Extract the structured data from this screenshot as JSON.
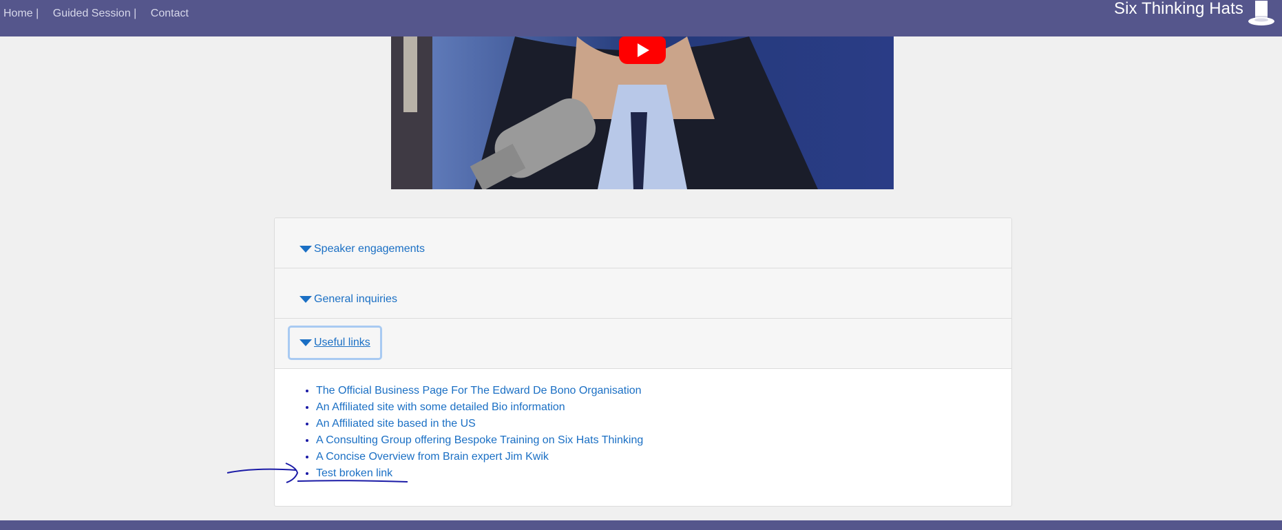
{
  "nav": {
    "home": "Home",
    "guided": "Guided Session",
    "contact": "Contact",
    "separator": "|"
  },
  "brand": {
    "title": "Six Thinking Hats",
    "icon": "top-hat-icon"
  },
  "video": {
    "play_icon": "youtube-play-icon"
  },
  "accordion": {
    "items": [
      {
        "label": "Speaker engagements"
      },
      {
        "label": "General inquiries"
      },
      {
        "label": "Useful links"
      }
    ]
  },
  "useful_links": [
    "The Official Business Page For The Edward De Bono Organisation",
    "An Affiliated site with some detailed Bio information",
    "An Affiliated site based in the US",
    "A Consulting Group offering Bespoke Training on Six Hats Thinking",
    "A Concise Overview from Brain expert Jim Kwik",
    "Test broken link"
  ],
  "colors": {
    "header": "#55568c",
    "link": "#1a6fc4",
    "annotation": "#1a1aa6"
  }
}
